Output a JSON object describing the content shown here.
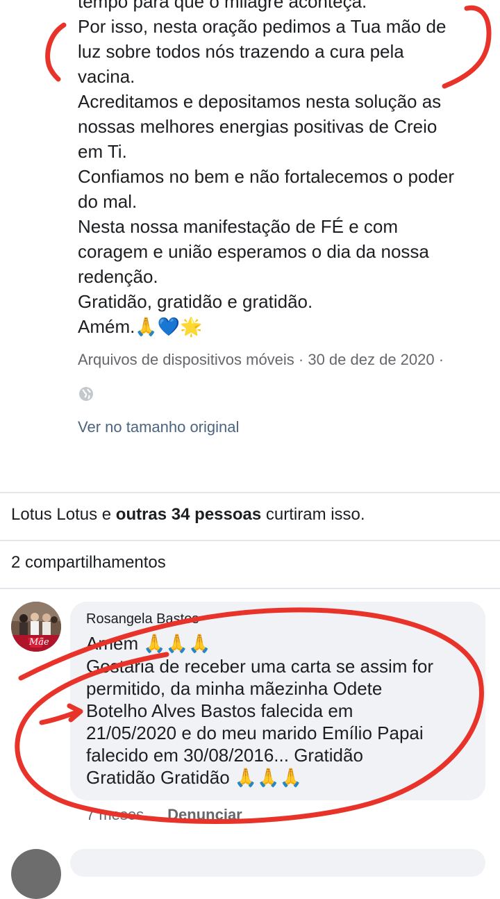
{
  "post": {
    "lines": [
      "tempo para que o milagre aconteça.",
      "Por isso, nesta oração pedimos a Tua mão de",
      "luz sobre todos nós trazendo a cura pela",
      "vacina.",
      "Acreditamos e depositamos nesta solução as",
      "nossas melhores energias positivas de Creio",
      "em Ti.",
      "Confiamos no bem e não fortalecemos o poder",
      "do mal.",
      "Nesta nossa manifestação de FÉ e com",
      "coragem e união esperamos o dia da nossa",
      "redenção.",
      "Gratidão, gratidão e gratidão.",
      "Amém."
    ],
    "amen_emojis": {
      "pray": "🙏",
      "heart": "💙",
      "sun": "🌟"
    },
    "meta_text": "Arquivos de dispositivos móveis · 30 de dez de 2020 ·",
    "globe_icon": "globe-icon",
    "view_original": "Ver no tamanho original"
  },
  "reactions": {
    "likes_prefix": "Lotus Lotus e ",
    "likes_bold": "outras 34 pessoas",
    "likes_suffix": " curtiram isso.",
    "shares": "2 compartilhamentos"
  },
  "comment": {
    "author": "Rosangela Bastos",
    "first_line": "Amém ",
    "first_emojis": "🙏🙏🙏",
    "lines": [
      "Gostaria de receber uma carta se assim for",
      "permitido, da minha mãezinha Odete",
      "Botelho Alves Bastos falecida em",
      "21/05/2020 e do meu marido Emílio Papai",
      "falecido em 30/08/2016... Gratidão"
    ],
    "last_line": "Gratidão Gratidão ",
    "last_emojis": "🙏🙏🙏",
    "time": "7 meses",
    "report": "Denunciar",
    "avatar_caption": "Mãe"
  },
  "colors": {
    "text": "#1c1e21",
    "muted": "#65676b",
    "link": "#4b6480",
    "bubble": "#f0f2f5",
    "annotation": "#e8332a"
  }
}
